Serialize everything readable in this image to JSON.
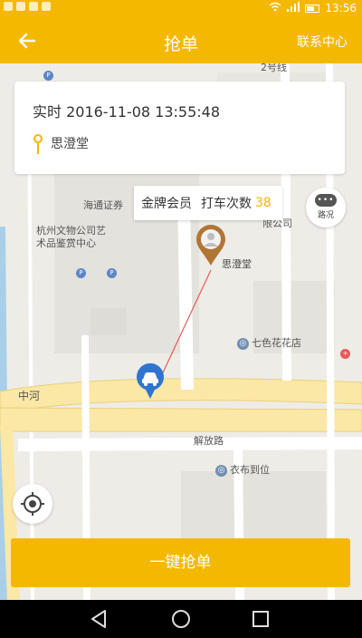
{
  "status_bar": {
    "time": "13:56"
  },
  "app_bar": {
    "back_icon": "arrow-left-icon",
    "title": "抢单",
    "contact_label": "联系中心"
  },
  "order_card": {
    "time_text": "实时 2016-11-08 13:55:48",
    "place": "思澄堂"
  },
  "member_tip": {
    "level": "金牌会员",
    "count_label": "打车次数",
    "count": "38"
  },
  "traffic_button": {
    "label": "路况"
  },
  "map": {
    "labels": {
      "haiyun": "海通证券",
      "cultural_a": "杭州文物公司艺",
      "cultural_b": "术品鉴赏中心",
      "company": "限公司",
      "pin_label": "思澄堂",
      "florist": "七色花花店",
      "jiefang": "解放路",
      "clothing": "衣布到位",
      "zhonghe": "中河",
      "subway": "2号线"
    },
    "accent_color": "#f5b800"
  },
  "grab_button": {
    "label": "一键抢单"
  },
  "nav_bar": {
    "icons": [
      "triangle-back-icon",
      "circle-home-icon",
      "square-recent-icon"
    ]
  }
}
